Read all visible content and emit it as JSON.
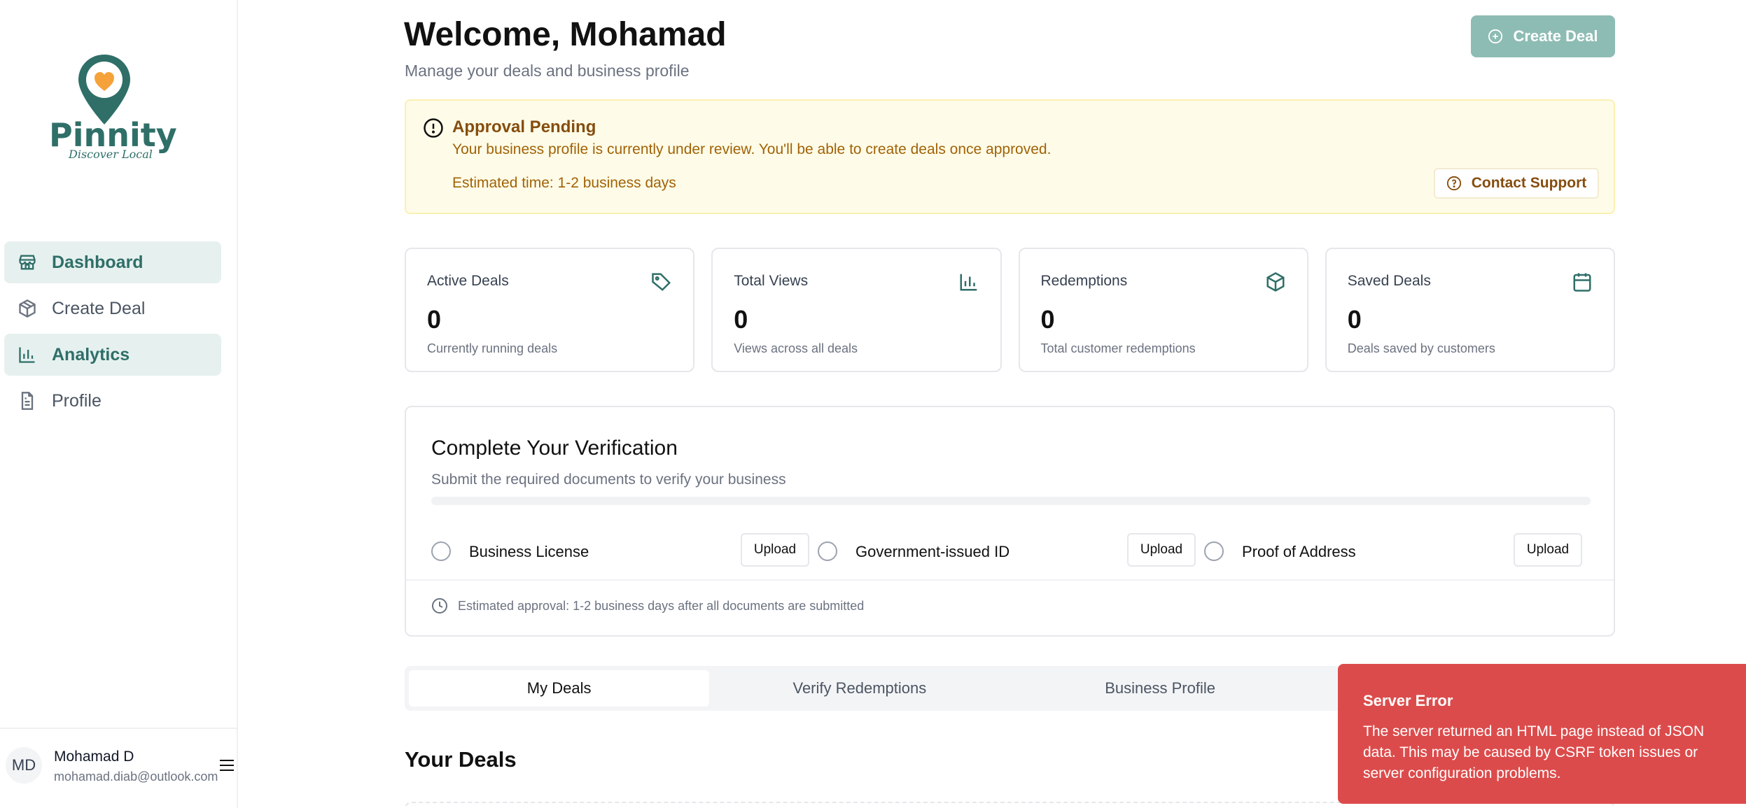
{
  "brand": {
    "name": "Pinnity",
    "tagline": "Discover Local"
  },
  "sidebar": {
    "items": [
      {
        "label": "Dashboard",
        "icon": "store-icon"
      },
      {
        "label": "Create Deal",
        "icon": "box-icon"
      },
      {
        "label": "Analytics",
        "icon": "bar-chart-icon"
      },
      {
        "label": "Profile",
        "icon": "document-icon"
      }
    ],
    "user": {
      "initials": "MD",
      "name": "Mohamad D",
      "email": "mohamad.diab@outlook.com"
    }
  },
  "header": {
    "title": "Welcome, Mohamad",
    "subtitle": "Manage your deals and business profile",
    "create_label": "Create Deal"
  },
  "alert": {
    "title": "Approval Pending",
    "text": "Your business profile is currently under review. You'll be able to create deals once approved.",
    "estimate": "Estimated time: 1-2 business days",
    "support_label": "Contact Support"
  },
  "stats": [
    {
      "label": "Active Deals",
      "value": "0",
      "desc": "Currently running deals",
      "icon": "tag-icon"
    },
    {
      "label": "Total Views",
      "value": "0",
      "desc": "Views across all deals",
      "icon": "bar-chart-icon"
    },
    {
      "label": "Redemptions",
      "value": "0",
      "desc": "Total customer redemptions",
      "icon": "package-icon"
    },
    {
      "label": "Saved Deals",
      "value": "0",
      "desc": "Deals saved by customers",
      "icon": "calendar-icon"
    }
  ],
  "verification": {
    "title": "Complete Your Verification",
    "subtitle": "Submit the required documents to verify your business",
    "progress": 0,
    "documents": [
      {
        "label": "Business License",
        "button": "Upload"
      },
      {
        "label": "Government-issued ID",
        "button": "Upload"
      },
      {
        "label": "Proof of Address",
        "button": "Upload"
      }
    ],
    "footer": "Estimated approval: 1-2 business days after all documents are submitted"
  },
  "tabs": [
    {
      "label": "My Deals"
    },
    {
      "label": "Verify Redemptions"
    },
    {
      "label": "Business Profile"
    },
    {
      "label": ""
    }
  ],
  "deals": {
    "title": "Your Deals"
  },
  "toast": {
    "title": "Server Error",
    "text": "The server returned an HTML page instead of JSON data. This may be caused by CSRF token issues or server configuration problems."
  },
  "colors": {
    "accent": "#2f6f68",
    "brand_orange": "#f5a23a",
    "error": "#dc4b4b",
    "warning_bg": "#fefce8"
  }
}
